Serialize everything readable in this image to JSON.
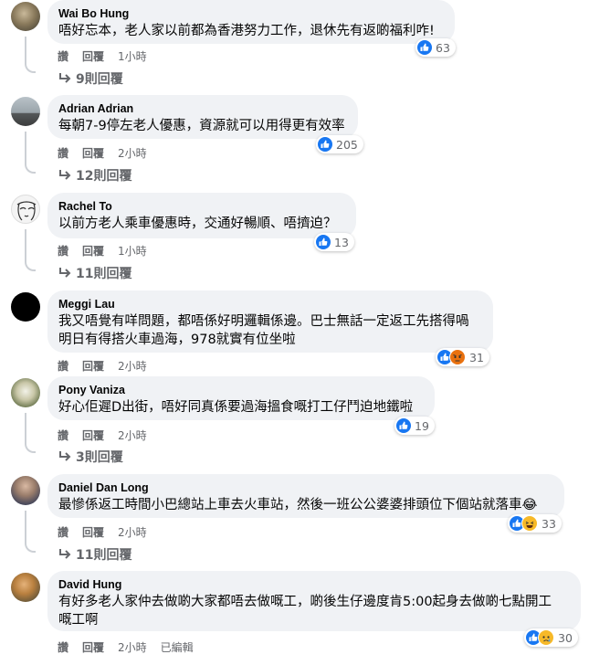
{
  "comments": [
    {
      "author": "Wai Bo Hung",
      "lines": [
        "唔好忘本，老人家以前都為香港努力工作，退休先有返啲福利咋!"
      ],
      "reactions": [
        "like"
      ],
      "count": "63",
      "actions": [
        "讚",
        "回覆"
      ],
      "time": "1小時",
      "replies": "9則回覆"
    },
    {
      "author": "Adrian Adrian",
      "lines": [
        "每朝7-9停左老人優惠，資源就可以用得更有效率"
      ],
      "reactions": [
        "like"
      ],
      "count": "205",
      "actions": [
        "讚",
        "回覆"
      ],
      "time": "2小時",
      "replies": "12則回覆"
    },
    {
      "author": "Rachel To",
      "lines": [
        "以前方老人乘車優惠時，交通好暢順、唔擠迫？"
      ],
      "reactions": [
        "like"
      ],
      "count": "13",
      "actions": [
        "讚",
        "回覆"
      ],
      "time": "1小時",
      "replies": "11則回覆"
    },
    {
      "author": "Meggi Lau",
      "lines": [
        "我又唔覺有咩問題，都唔係好明邏輯係邊。巴士無話一定返工先搭得喎",
        "明日有得搭火車過海，978就實有位坐啦"
      ],
      "reactions": [
        "like",
        "angry"
      ],
      "count": "31",
      "actions": [
        "讚",
        "回覆"
      ],
      "time": "2小時",
      "replies": ""
    },
    {
      "author": "Pony Vaniza",
      "lines": [
        "好心佢遲D出街，唔好同真係要過海搵食嘅打工仔鬥迫地鐵啦"
      ],
      "reactions": [
        "like"
      ],
      "count": "19",
      "actions": [
        "讚",
        "回覆"
      ],
      "time": "2小時",
      "replies": "3則回覆"
    },
    {
      "author": "Daniel Dan Long",
      "lines": [
        "最慘係返工時間小巴總站上車去火車站，然後一班公公婆婆排頭位下個站就落車😂"
      ],
      "reactions": [
        "like",
        "haha"
      ],
      "count": "33",
      "actions": [
        "讚",
        "回覆"
      ],
      "time": "2小時",
      "replies": "11則回覆"
    },
    {
      "author": "David Hung",
      "lines": [
        "有好多老人家仲去做啲大家都唔去做嘅工，啲後生仔邊度肯5:00起身去做啲七點開工",
        "嘅工啊"
      ],
      "reactions": [
        "like",
        "sad"
      ],
      "count": "30",
      "actions": [
        "讚",
        "回覆"
      ],
      "time": "2小時",
      "edited": "已編輯",
      "replies": ""
    }
  ],
  "colors": {
    "like": "#1877f2",
    "bubble": "#f0f2f5",
    "muted": "#65676b"
  }
}
